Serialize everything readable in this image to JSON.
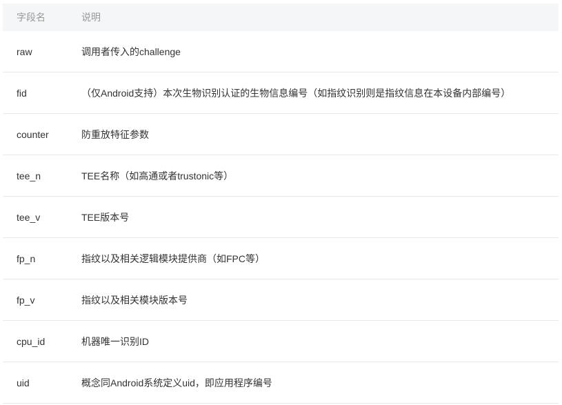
{
  "table": {
    "headers": [
      "字段名",
      "说明"
    ],
    "rows": [
      {
        "field": "raw",
        "description": "调用者传入的challenge"
      },
      {
        "field": "fid",
        "description": "（仅Android支持）本次生物识别认证的生物信息编号（如指纹识别则是指纹信息在本设备内部编号）"
      },
      {
        "field": "counter",
        "description": "防重放特征参数"
      },
      {
        "field": "tee_n",
        "description": "TEE名称（如高通或者trustonic等）"
      },
      {
        "field": "tee_v",
        "description": "TEE版本号"
      },
      {
        "field": "fp_n",
        "description": "指纹以及相关逻辑模块提供商（如FPC等）"
      },
      {
        "field": "fp_v",
        "description": "指纹以及相关模块版本号"
      },
      {
        "field": "cpu_id",
        "description": "机器唯一识别ID"
      },
      {
        "field": "uid",
        "description": "概念同Android系统定义uid，即应用程序编号"
      }
    ]
  },
  "colors": {
    "header_bg": "#f5f6f8",
    "header_text": "#999999",
    "body_text": "#333333",
    "row_divider": "#e8e8e8"
  }
}
